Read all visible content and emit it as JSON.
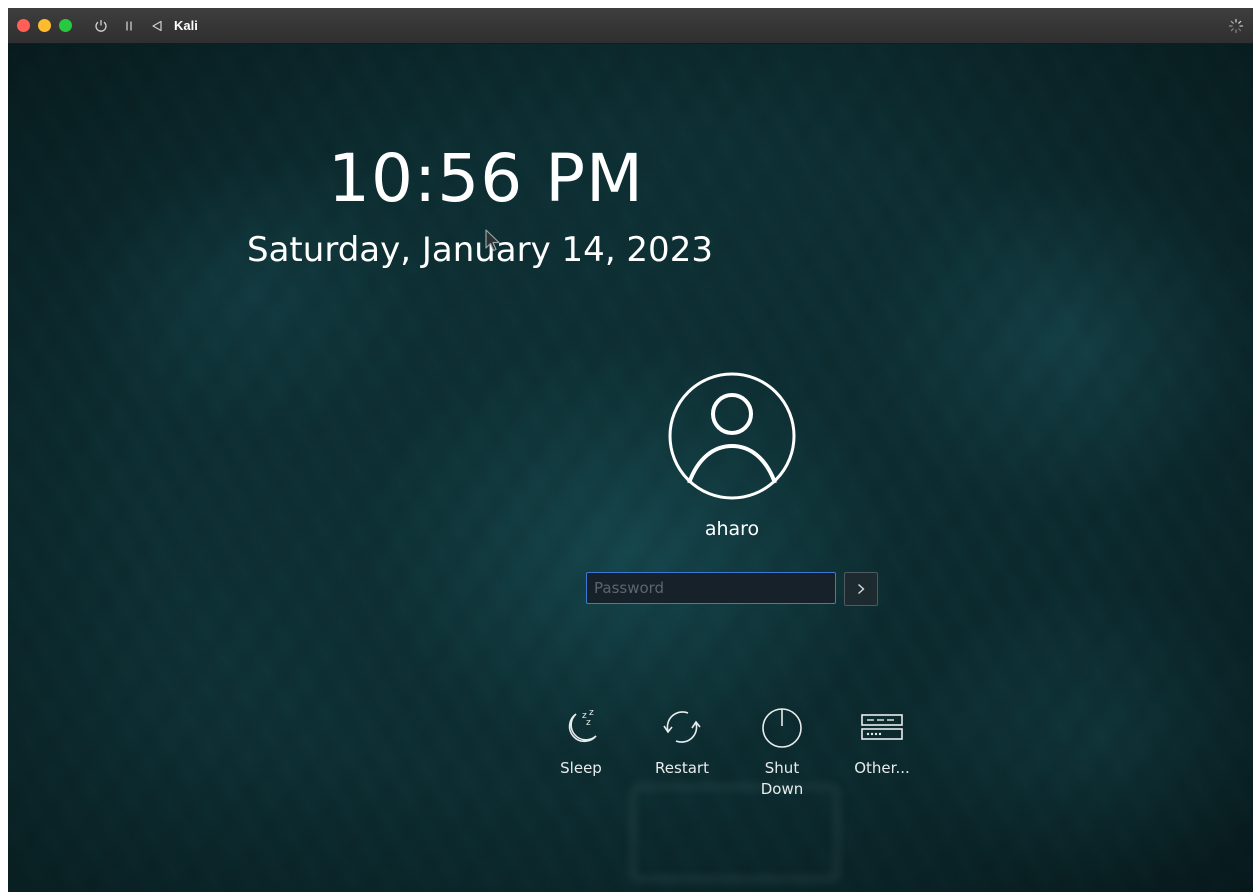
{
  "window": {
    "title": "Kali",
    "traffic_lights": {
      "close": "#ff5f57",
      "minimize": "#febc2e",
      "zoom": "#28c840"
    },
    "toolbar_icons": [
      "power-icon",
      "pause-icon",
      "back-icon"
    ],
    "status_icon": "spinner-icon"
  },
  "lockscreen": {
    "time": "10:56 PM",
    "date": "Saturday, January 14, 2023",
    "user": {
      "name": "aharo",
      "avatar_icon": "user-avatar-icon"
    },
    "password": {
      "placeholder": "Password",
      "value": ""
    },
    "submit_icon": "chevron-right-icon",
    "accent_color": "#3c78d8"
  },
  "actions": {
    "sleep": {
      "label": "Sleep",
      "icon": "sleep-icon"
    },
    "restart": {
      "label": "Restart",
      "icon": "restart-icon"
    },
    "shutdown": {
      "label": "Shut Down",
      "icon": "power-icon"
    },
    "other": {
      "label": "Other...",
      "icon": "other-options-icon"
    }
  }
}
